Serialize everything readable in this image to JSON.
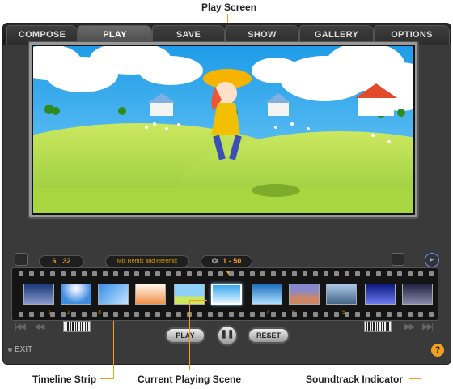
{
  "callouts": {
    "play_screen": "Play Screen",
    "timeline_strip": "Timeline Strip",
    "current_scene": "Current Playing Scene",
    "soundtrack": "Soundtrack Indicator"
  },
  "tabs": [
    "COMPOSE",
    "PLAY",
    "SAVE",
    "SHOW",
    "GALLERY",
    "OPTIONS"
  ],
  "active_tab": "PLAY",
  "counter": {
    "current": "6",
    "total": "32"
  },
  "music_title": "Mix Remix and Reremix",
  "scene_range": "1 - 50",
  "buttons": {
    "play": "PLAY",
    "reset": "RESET",
    "exit": "EXIT",
    "help": "?"
  },
  "strip_numbers": [
    "1",
    "2",
    "3",
    "7",
    "8",
    "9"
  ],
  "colors": {
    "accent": "#f0a020",
    "frame": "#3a3a3a",
    "tab_active": "#5a5a5a"
  }
}
